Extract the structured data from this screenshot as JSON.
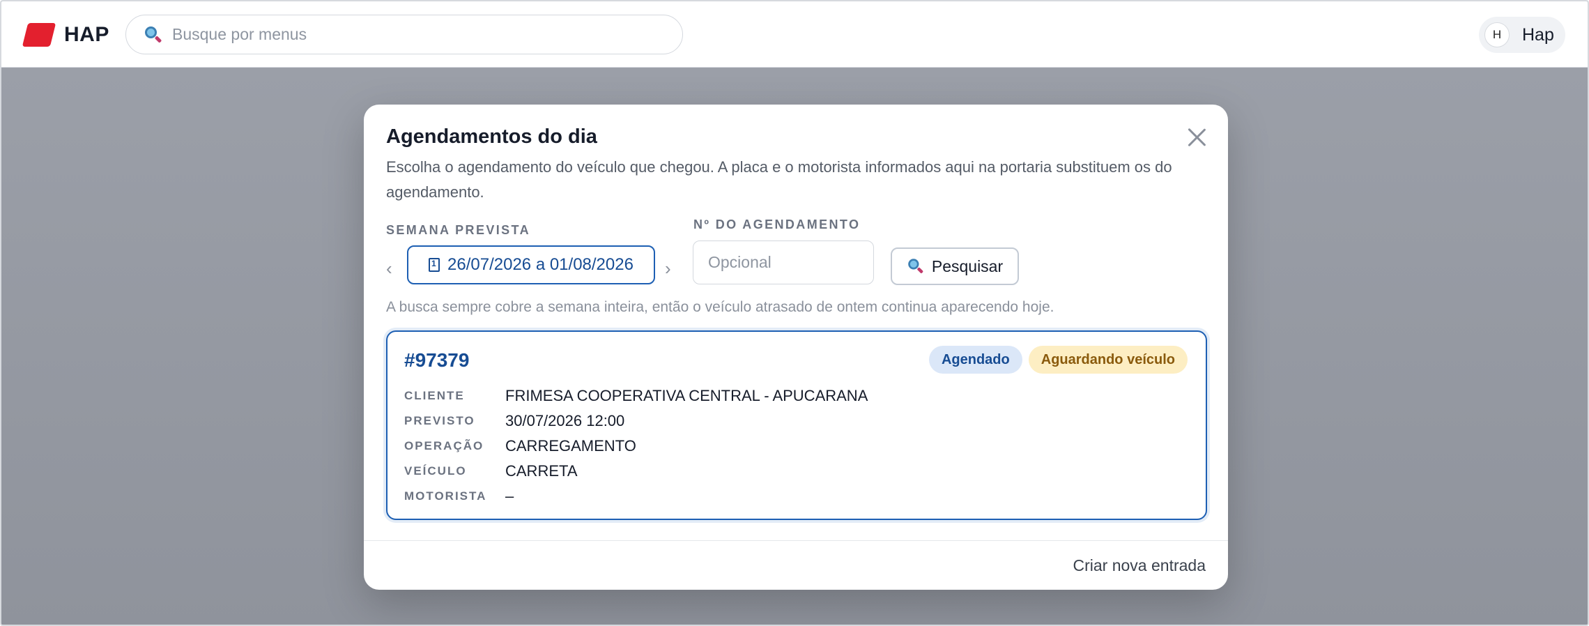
{
  "topbar": {
    "brand": "HAP",
    "search_placeholder": "Busque por menus",
    "user_initial": "H",
    "user_name": "Hap"
  },
  "modal": {
    "title": "Agendamentos do dia",
    "description": "Escolha o agendamento do veículo que chegou. A placa e o motorista informados aqui na portaria substituem os do agendamento.",
    "week_label": "SEMANA PREVISTA",
    "week_range": "26/07/2026 a 01/08/2026",
    "prev_arrow": "‹",
    "next_arrow": "›",
    "number_label": "Nº DO AGENDAMENTO",
    "number_placeholder": "Opcional",
    "search_button": "Pesquisar",
    "hint": "A busca sempre cobre a semana inteira, então o veículo atrasado de ontem continua aparecendo hoje.",
    "footer_action": "Criar nova entrada"
  },
  "card": {
    "id": "#97379",
    "badges": [
      "Agendado",
      "Aguardando veículo"
    ],
    "rows": [
      {
        "key": "CLIENTE",
        "value": "FRIMESA COOPERATIVA CENTRAL - APUCARANA"
      },
      {
        "key": "PREVISTO",
        "value": "30/07/2026 12:00"
      },
      {
        "key": "OPERAÇÃO",
        "value": "CARREGAMENTO"
      },
      {
        "key": "VEÍCULO",
        "value": "CARRETA"
      },
      {
        "key": "MOTORISTA",
        "value": "–"
      }
    ]
  },
  "colors": {
    "accent": "#1d5fb3",
    "brand_red": "#e3202e",
    "badge_blue_bg": "#dbe7f8",
    "badge_yellow_bg": "#fdeec3"
  }
}
